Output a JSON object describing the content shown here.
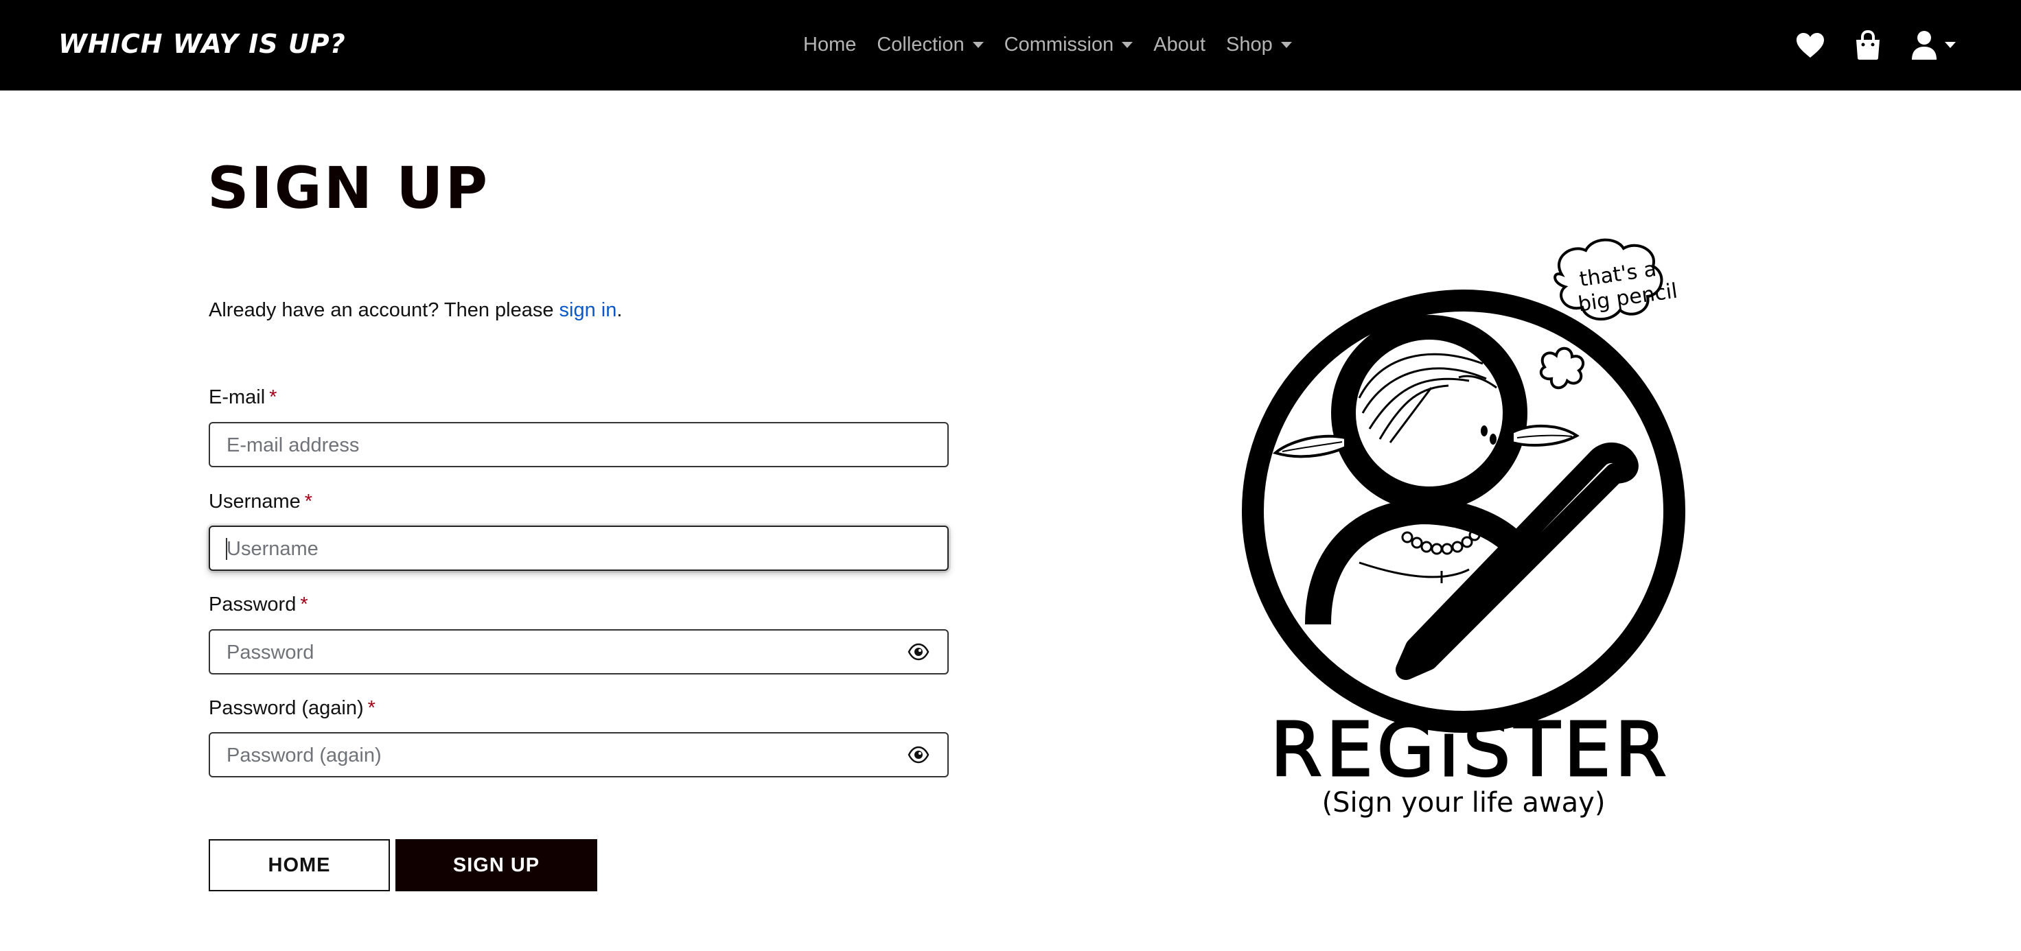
{
  "navbar": {
    "brand": "WHICH WAY IS UP?",
    "links": [
      {
        "label": "Home",
        "dropdown": false
      },
      {
        "label": "Collection",
        "dropdown": true
      },
      {
        "label": "Commission",
        "dropdown": true
      },
      {
        "label": "About",
        "dropdown": false
      },
      {
        "label": "Shop",
        "dropdown": true
      }
    ],
    "icons": [
      "heart-icon",
      "shopping-bag-icon",
      "user-icon"
    ]
  },
  "page": {
    "title": "SIGN UP",
    "already_text": "Already have an account? Then please ",
    "signin_link": "sign in",
    "already_end": "."
  },
  "form": {
    "required_mark": "*",
    "email": {
      "label": "E-mail",
      "placeholder": "E-mail address",
      "value": ""
    },
    "username": {
      "label": "Username",
      "placeholder": "Username",
      "value": ""
    },
    "password": {
      "label": "Password",
      "placeholder": "Password",
      "value": ""
    },
    "password2": {
      "label": "Password (again)",
      "placeholder": "Password (again)",
      "value": ""
    }
  },
  "buttons": {
    "home": "HOME",
    "signup": "SIGN UP"
  },
  "illustration": {
    "speech_line1": "that's a",
    "speech_line2": "big pencil",
    "title": "REGiSTER",
    "subtitle": "(Sign your life away)"
  },
  "colors": {
    "navbar": "#000000",
    "link": "#0a58ca",
    "required": "#a30018",
    "primary_button": "#110000"
  }
}
